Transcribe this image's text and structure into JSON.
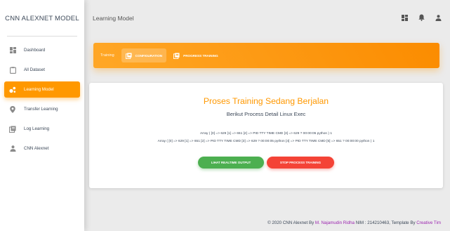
{
  "sidebar": {
    "brand": "CNN ALEXNET MODEL",
    "items": [
      {
        "label": "Dashboard",
        "icon": "dashboard-icon",
        "active": false
      },
      {
        "label": "All Dataset",
        "icon": "clipboard-icon",
        "active": false
      },
      {
        "label": "Learning Model",
        "icon": "bubble-chart-icon",
        "active": true
      },
      {
        "label": "Transfer Learning",
        "icon": "location-pin-icon",
        "active": false
      },
      {
        "label": "Log Learning",
        "icon": "library-books-icon",
        "active": false
      },
      {
        "label": "CNN Alexnet",
        "icon": "person-icon",
        "active": false
      }
    ]
  },
  "topbar": {
    "title": "Learning Model",
    "icons": [
      "dashboard-icon",
      "notifications-icon",
      "person-icon"
    ]
  },
  "tabs_bar": {
    "label": "Training",
    "tabs": [
      {
        "label": "CONFIGURATION",
        "selected": true
      },
      {
        "label": "PROGRESS TRAINING",
        "selected": false
      }
    ]
  },
  "card": {
    "title": "Proses Training Sedang Berjalan",
    "subtitle": "Berikut Process Detail Linux Exec",
    "line1": "Array ( [0] => 629 [1] => 651 [2] => PID TTY TIME CMD [3] => 629 ? 00:00:05 python ) 1",
    "line2": "Array ( [0] => 629 [1] => 651 [2] => PID TTY TIME CMD [3] => 629 ? 00:00:05 python [4] => PID TTY TIME CMD [5] => 651 ? 00:00:00 python ) 1",
    "button_output": "LIHAT REALTIME OUTPUT",
    "button_stop": "STOP PROCESS TRAINING"
  },
  "footer": {
    "prefix": "© 2020 CNN Alexnet By ",
    "author": "M. Najamudin Ridha",
    "middle": " NIM : 214210463, Template By ",
    "template_by": "Creative Tim"
  },
  "colors": {
    "accent": "#ff9800",
    "success": "#4caf50",
    "danger": "#f44336",
    "link": "#9c27b0"
  }
}
